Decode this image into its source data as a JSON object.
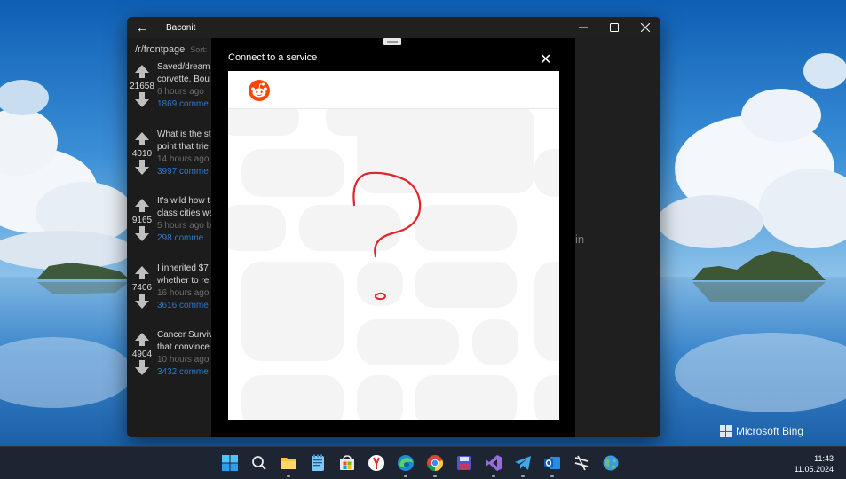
{
  "desktop": {
    "watermark": "Microsoft Bing"
  },
  "window": {
    "title": "Baconit",
    "controls": [
      "minimize",
      "maximize",
      "close"
    ]
  },
  "sidebar": {
    "subreddit": "/r/frontpage",
    "sort_label": "Sort:",
    "posts": [
      {
        "score": "21658",
        "title": [
          "Saved/dream",
          "corvette. Bou"
        ],
        "meta": "6 hours ago",
        "comments": "1869 comme"
      },
      {
        "score": "4010",
        "title": [
          "What is the st",
          "point that trie"
        ],
        "meta": "14 hours ago",
        "comments": "3997 comme"
      },
      {
        "score": "9165",
        "title": [
          "It's wild how t",
          "class cities we"
        ],
        "meta": "5 hours ago b",
        "comments": "298 comme"
      },
      {
        "score": "7406",
        "title": [
          "I inherited $7",
          "whether to re"
        ],
        "meta": "16 hours ago",
        "comments": "3616 comme"
      },
      {
        "score": "4904",
        "title": [
          "Cancer Surviv",
          "that convince"
        ],
        "meta": "10 hours ago",
        "comments": "3432 comme"
      }
    ]
  },
  "right_pane": {
    "partial_text": "in"
  },
  "modal": {
    "title": "Connect to a service",
    "close_glyph": "✕",
    "brand_color": "#ff4500"
  },
  "taskbar": {
    "icons": [
      "windows-start-icon",
      "search-icon",
      "file-explorer-icon",
      "notepad-icon",
      "microsoft-store-icon",
      "yandex-browser-icon",
      "edge-icon",
      "chrome-icon",
      "save-disk-icon",
      "visual-studio-icon",
      "telegram-icon",
      "outlook-icon",
      "baconit-icon",
      "globe-app-icon"
    ],
    "time": "11:43",
    "date": "11.05.2024"
  }
}
